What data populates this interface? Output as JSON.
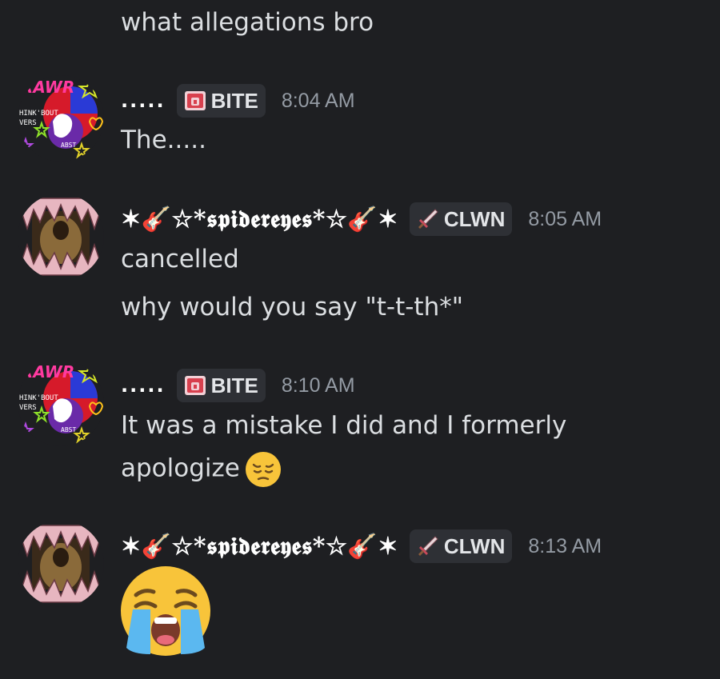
{
  "messages": {
    "m0": {
      "text": "what allegations bro"
    },
    "m1": {
      "username": ".....",
      "tag": "BITE",
      "tag_icon": "castle-icon",
      "time": "8:04 AM",
      "lines": [
        "The....."
      ]
    },
    "m2": {
      "username": "✶🎸☆*𝖘𝖕𝖎𝖉𝖊𝖗𝖊𝖞𝖊𝖘*☆🎸✶",
      "tag": "CLWN",
      "tag_icon": "sword-icon",
      "time": "8:05 AM",
      "lines": [
        "cancelled",
        "why would you say \"t-t-th*\""
      ]
    },
    "m3": {
      "username": ".....",
      "tag": "BITE",
      "tag_icon": "castle-icon",
      "time": "8:10 AM",
      "lines": [
        "It was a mistake I did and I formerly",
        "apologize"
      ]
    },
    "m4": {
      "username": "✶🎸☆*𝖘𝖕𝖎𝖉𝖊𝖗𝖊𝖞𝖊𝖘*☆🎸✶",
      "tag": "CLWN",
      "tag_icon": "sword-icon",
      "time": "8:13 AM",
      "emoji": "loudly-crying-face-icon"
    }
  },
  "colors": {
    "background": "#1e1f22",
    "text": "#dbdee1",
    "timestamp": "#949ba4",
    "tag_bg": "#2e3035"
  }
}
